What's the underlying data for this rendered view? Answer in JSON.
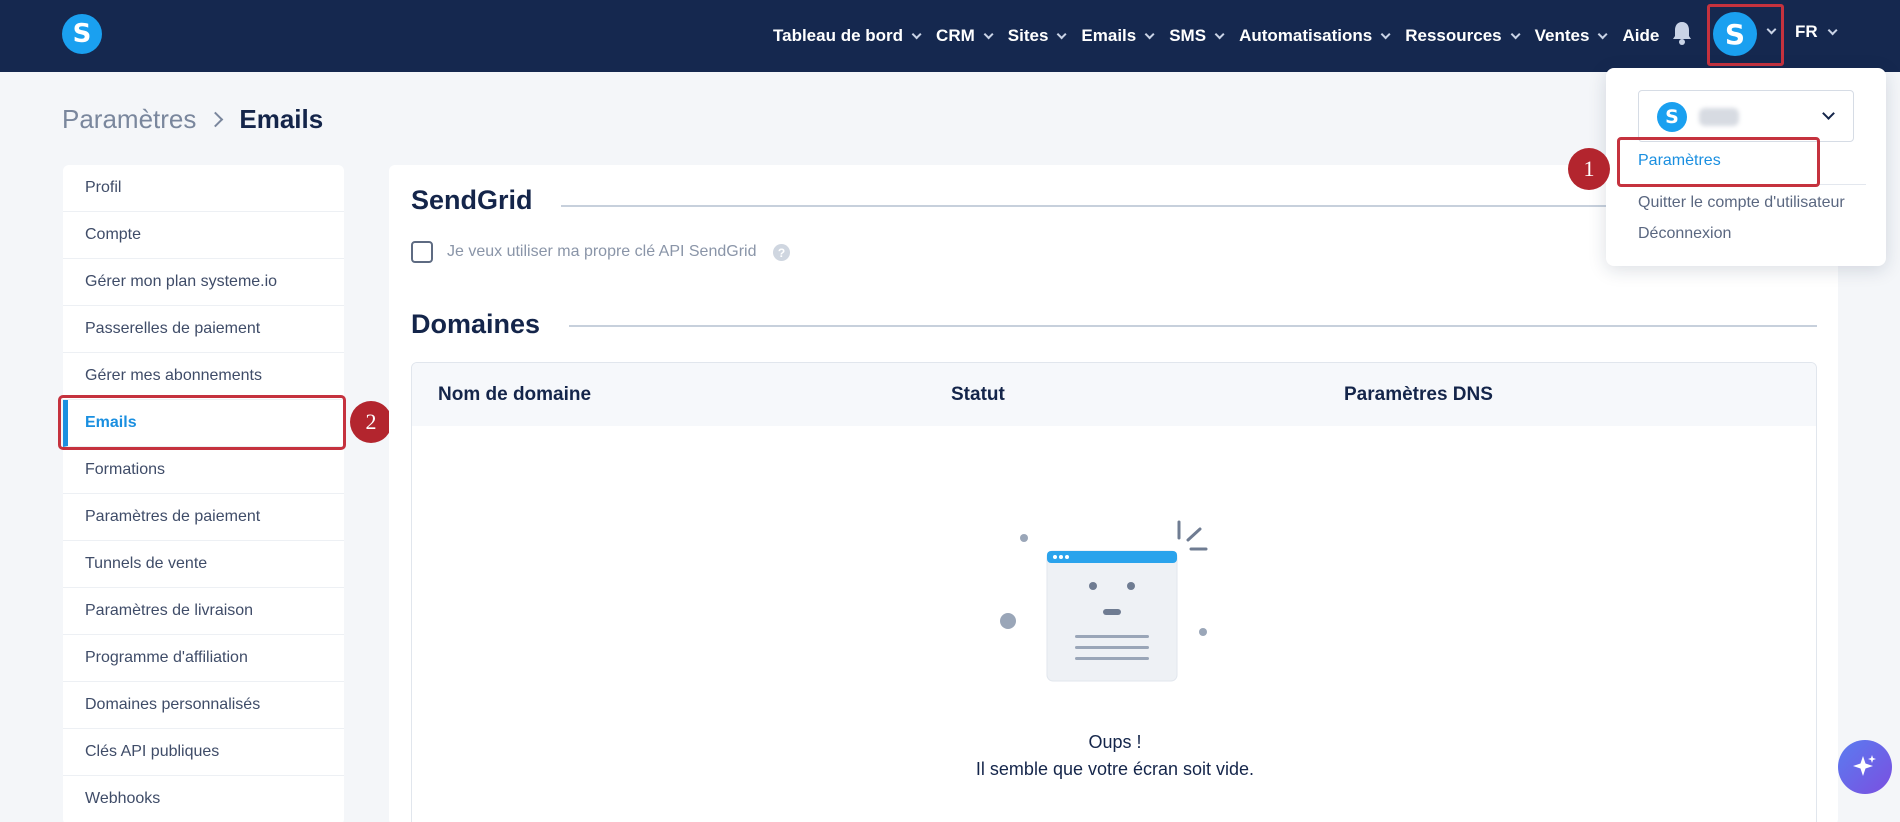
{
  "nav": {
    "items": [
      {
        "label": "Tableau de bord",
        "dropdown": true
      },
      {
        "label": "CRM",
        "dropdown": true
      },
      {
        "label": "Sites",
        "dropdown": true
      },
      {
        "label": "Emails",
        "dropdown": true
      },
      {
        "label": "SMS",
        "dropdown": true
      },
      {
        "label": "Automatisations",
        "dropdown": true
      },
      {
        "label": "Ressources",
        "dropdown": true
      },
      {
        "label": "Ventes",
        "dropdown": true
      },
      {
        "label": "Aide",
        "dropdown": false
      }
    ],
    "logo_letter": "S",
    "avatar_letter": "S",
    "language": "FR"
  },
  "breadcrumb": {
    "parent": "Paramètres",
    "current": "Emails"
  },
  "sidebar": {
    "items": [
      {
        "label": "Profil"
      },
      {
        "label": "Compte"
      },
      {
        "label": "Gérer mon plan systeme.io"
      },
      {
        "label": "Passerelles de paiement"
      },
      {
        "label": "Gérer mes abonnements"
      },
      {
        "label": "Emails",
        "active": true
      },
      {
        "label": "Formations"
      },
      {
        "label": "Paramètres de paiement"
      },
      {
        "label": "Tunnels de vente"
      },
      {
        "label": "Paramètres de livraison"
      },
      {
        "label": "Programme d'affiliation"
      },
      {
        "label": "Domaines personnalisés"
      },
      {
        "label": "Clés API publiques"
      },
      {
        "label": "Webhooks"
      }
    ]
  },
  "main": {
    "sendgrid_title": "SendGrid",
    "sendgrid_checkbox_label": "Je veux utiliser ma propre clé API SendGrid",
    "help_glyph": "?",
    "domains_title": "Domaines",
    "table_headers": [
      "Nom de domaine",
      "Statut",
      "Paramètres DNS"
    ],
    "empty_title": "Oups !",
    "empty_message": "Il semble que votre écran soit vide."
  },
  "dropdown": {
    "account_logo_letter": "S",
    "links": [
      "Paramètres",
      "Quitter le compte d'utilisateur",
      "Déconnexion"
    ]
  },
  "annotations": {
    "step1": "1",
    "step2": "2"
  },
  "colors": {
    "topbar": "#15284f",
    "brand_blue": "#1aa0f0",
    "link_blue": "#1a8fe0",
    "annotation_red": "#c5323e",
    "text_dark": "#14254a"
  }
}
